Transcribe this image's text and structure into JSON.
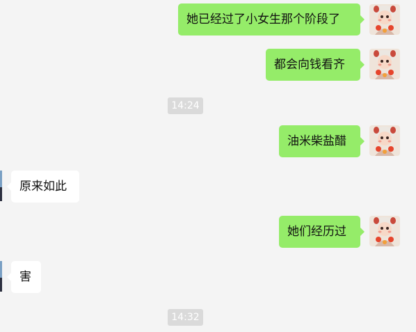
{
  "messages": [
    {
      "sender": "me",
      "text": "她已经过了小女生那个阶段了"
    },
    {
      "sender": "me",
      "text": "都会向钱看齐"
    },
    {
      "type": "timestamp",
      "text": "14:24"
    },
    {
      "sender": "me",
      "text": "油米柴盐醋"
    },
    {
      "sender": "them",
      "text": "原来如此"
    },
    {
      "sender": "me",
      "text": "她们经历过"
    },
    {
      "sender": "them",
      "text": "害"
    },
    {
      "type": "timestamp",
      "text": "14:32"
    }
  ],
  "colors": {
    "background": "#f4f4f4",
    "my_bubble": "#95ec69",
    "their_bubble": "#ffffff",
    "timestamp_bg": "#dadada",
    "timestamp_text": "#ffffff"
  },
  "icons": {
    "my_avatar": "cartoon-girl-avatar-icon",
    "their_avatar": "partial-avatar-icon"
  }
}
